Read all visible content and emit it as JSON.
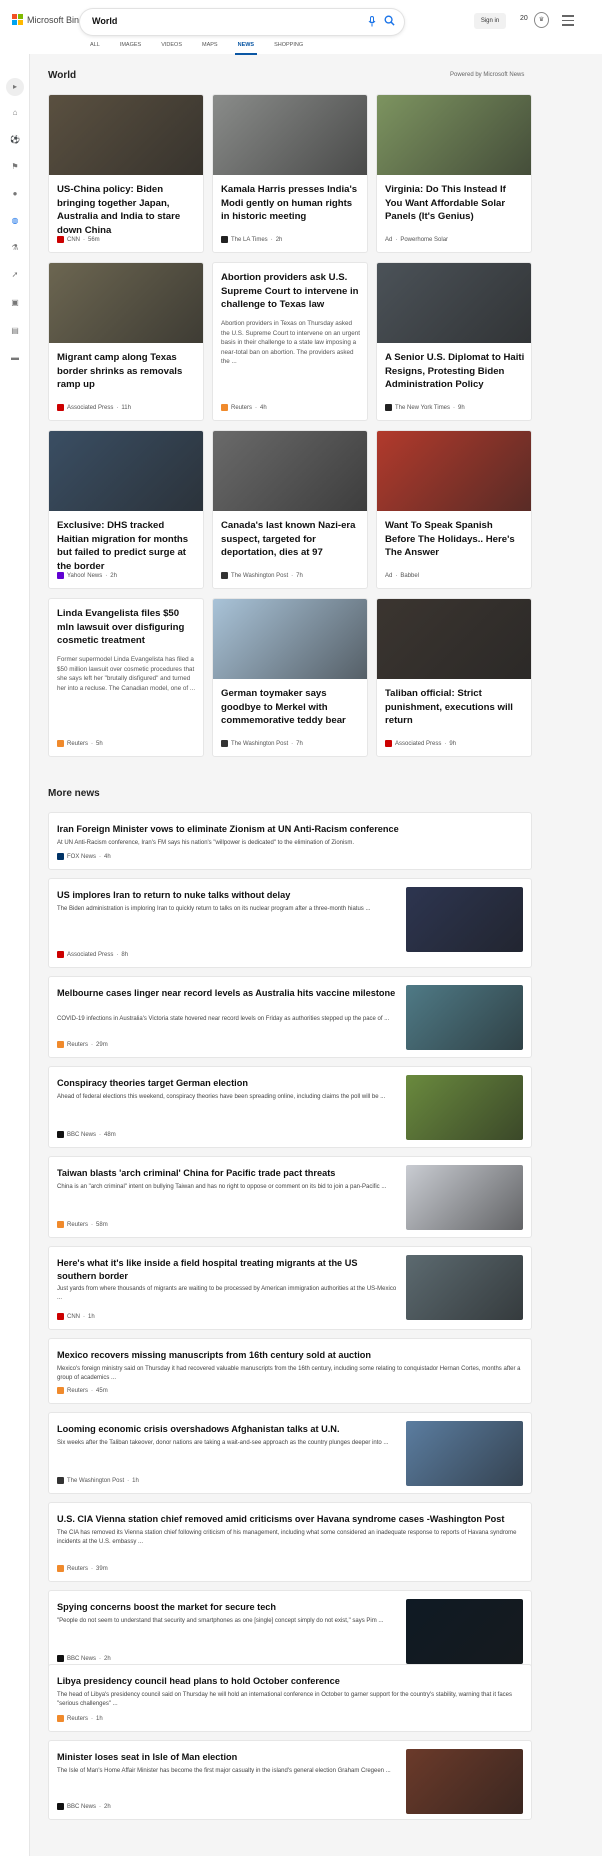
{
  "header": {
    "brand": "Microsoft Bing",
    "search_query": "World",
    "mic_icon": "microphone-icon",
    "search_icon": "search-icon",
    "signin": "Sign in",
    "rewards_count": "20",
    "tabs": [
      "ALL",
      "IMAGES",
      "VIDEOS",
      "MAPS",
      "NEWS",
      "SHOPPING"
    ],
    "active_tab": "NEWS"
  },
  "sidebar": {
    "icons": [
      "expand-icon",
      "home-icon",
      "sports-icon",
      "flag-icon",
      "location-pin-icon",
      "globe-icon",
      "science-icon",
      "rocket-icon",
      "entertainment-icon",
      "money-icon",
      "media-icon"
    ]
  },
  "section": {
    "title": "World",
    "powered": "Powered by Microsoft News"
  },
  "cards": [
    {
      "title": "US-China policy: Biden bringing together Japan, Australia and India to stare down China",
      "snippet": "",
      "source": "CNN",
      "time": "56m",
      "ad": false,
      "badge": "#cc0000",
      "img": "#5a5040"
    },
    {
      "title": "Kamala Harris presses India's Modi gently on human rights in historic meeting",
      "snippet": "",
      "source": "The LA Times",
      "time": "2h",
      "ad": false,
      "badge": "#222222",
      "img": "#8a8c8a"
    },
    {
      "title": "Virginia: Do This Instead If You Want Affordable Solar Panels (It's Genius)",
      "snippet": "",
      "source": "Powerhome Solar",
      "time": "",
      "ad": true,
      "badge": "",
      "img": "#7d9460"
    },
    {
      "title": "Migrant camp along Texas border shrinks as removals ramp up",
      "snippet": "",
      "source": "Associated Press",
      "time": "11h",
      "ad": false,
      "badge": "#cc0000",
      "img": "#6c6651"
    },
    {
      "title": "Abortion providers ask U.S. Supreme Court to intervene in challenge to Texas law",
      "snippet": "Abortion providers in Texas on Thursday asked the U.S. Supreme Court to intervene on an urgent basis in their challenge to a state law imposing a near-total ban on abortion. The providers asked the ...",
      "source": "Reuters",
      "time": "4h",
      "ad": false,
      "badge": "#f08a2c",
      "img": ""
    },
    {
      "title": "A Senior U.S. Diplomat to Haiti Resigns, Protesting Biden Administration Policy",
      "snippet": "",
      "source": "The New York Times",
      "time": "9h",
      "ad": false,
      "badge": "#222222",
      "img": "#4b5258"
    },
    {
      "title": "Exclusive: DHS tracked Haitian migration for months but failed to predict surge at the border",
      "snippet": "",
      "source": "Yahoo! News",
      "time": "2h",
      "ad": false,
      "badge": "#6001d2",
      "img": "#3a4e63"
    },
    {
      "title": "Canada's last known Nazi-era suspect, targeted for deportation, dies at 97",
      "snippet": "",
      "source": "The Washington Post",
      "time": "7h",
      "ad": false,
      "badge": "#333333",
      "img": "#6a6a6a"
    },
    {
      "title": "Want To Speak Spanish Before The Holidays.. Here's The Answer",
      "snippet": "",
      "source": "Babbel",
      "time": "",
      "ad": true,
      "badge": "",
      "img": "#b23a2c"
    },
    {
      "title": "Linda Evangelista files $50 mln lawsuit over disfiguring cosmetic treatment",
      "snippet": "Former supermodel Linda Evangelista has filed a $50 million lawsuit over cosmetic procedures that she says left her \"brutally disfigured\" and turned her into a recluse. The Canadian model, one of ...",
      "source": "Reuters",
      "time": "5h",
      "ad": false,
      "badge": "#f08a2c",
      "img": ""
    },
    {
      "title": "German toymaker says goodbye to Merkel with commemorative teddy bear",
      "snippet": "",
      "source": "The Washington Post",
      "time": "7h",
      "ad": false,
      "badge": "#333333",
      "img": "#a9c3d8"
    },
    {
      "title": "Taliban official: Strict punishment, executions will return",
      "snippet": "",
      "source": "Associated Press",
      "time": "9h",
      "ad": false,
      "badge": "#cc0000",
      "img": "#3b3530"
    }
  ],
  "more_news": {
    "title": "More news",
    "items": [
      {
        "title": "Iran Foreign Minister vows to eliminate Zionism at UN Anti-Racism conference",
        "snippet": "At UN Anti-Racism conference, Iran's FM says his nation's \"willpower is dedicated\" to the elimination of Zionism.",
        "source": "FOX News",
        "time": "4h",
        "badge": "#003366",
        "img": ""
      },
      {
        "title": "US implores Iran to return to nuke talks without delay",
        "snippet": "The Biden administration is imploring Iran to quickly return to talks on its nuclear program after a three-month hiatus ...",
        "source": "Associated Press",
        "time": "8h",
        "badge": "#cc0000",
        "img": "#2d3550"
      },
      {
        "title": "Melbourne cases linger near record levels as Australia hits vaccine milestone",
        "snippet": "COVID-19 infections in Australia's Victoria state hovered near record levels on Friday as authorities stepped up the pace of ...",
        "source": "Reuters",
        "time": "29m",
        "badge": "#f08a2c",
        "img": "#4f7a86"
      },
      {
        "title": "Conspiracy theories target German election",
        "snippet": "Ahead of federal elections this weekend, conspiracy theories have been spreading online, including claims the poll will be ...",
        "source": "BBC News",
        "time": "48m",
        "badge": "#111111",
        "img": "#6a8a3e"
      },
      {
        "title": "Taiwan blasts 'arch criminal' China for Pacific trade pact threats",
        "snippet": "China is an \"arch criminal\" intent on bullying Taiwan and has no right to oppose or comment on its bid to join a pan-Pacific ...",
        "source": "Reuters",
        "time": "58m",
        "badge": "#f08a2c",
        "img": "#c9ccd2"
      },
      {
        "title": "Here's what it's like inside a field hospital treating migrants at the US southern border",
        "snippet": "Just yards from where thousands of migrants are waiting to be processed by American immigration authorities at the US-Mexico ...",
        "source": "CNN",
        "time": "1h",
        "badge": "#cc0000",
        "img": "#5c6a70"
      },
      {
        "title": "Mexico recovers missing manuscripts from 16th century sold at auction",
        "snippet": "Mexico's foreign ministry said on Thursday it had recovered valuable manuscripts from the 16th century, including some relating to conquistador Hernan Cortes, months after a group of academics ...",
        "source": "Reuters",
        "time": "45m",
        "badge": "#f08a2c",
        "img": ""
      },
      {
        "title": "Looming economic crisis overshadows Afghanistan talks at U.N.",
        "snippet": "Six weeks after the Taliban takeover, donor nations are taking a wait-and-see approach as the country plunges deeper into ...",
        "source": "The Washington Post",
        "time": "1h",
        "badge": "#333333",
        "img": "#5b7da0"
      },
      {
        "title": "U.S. CIA Vienna station chief removed amid criticisms over Havana syndrome cases -Washington Post",
        "snippet": "The CIA has removed its Vienna station chief following criticism of his management, including what some considered an inadequate response to reports of Havana syndrome incidents at the U.S. embassy ...",
        "source": "Reuters",
        "time": "39m",
        "badge": "#f08a2c",
        "img": ""
      },
      {
        "title": "Spying concerns boost the market for secure tech",
        "snippet": "\"People do not seem to understand that security and smartphones as one [single] concept simply do not exist,\" says Pim ...",
        "source": "BBC News",
        "time": "2h",
        "badge": "#111111",
        "img": "#0f1a24"
      },
      {
        "title": "Libya presidency council head plans to hold October conference",
        "snippet": "The head of Libya's presidency council said on Thursday he will hold an international conference in October to garner support for the country's stability, warning that it faces \"serious challenges\" ...",
        "source": "Reuters",
        "time": "1h",
        "badge": "#f08a2c",
        "img": ""
      },
      {
        "title": "Minister loses seat in Isle of Man election",
        "snippet": "The Isle of Man's Home Affair Minister has become the first major casualty in the island's general election Graham Cregeen ...",
        "source": "BBC News",
        "time": "2h",
        "badge": "#111111",
        "img": "#6b3a2a"
      }
    ]
  },
  "ad_label": "Ad"
}
